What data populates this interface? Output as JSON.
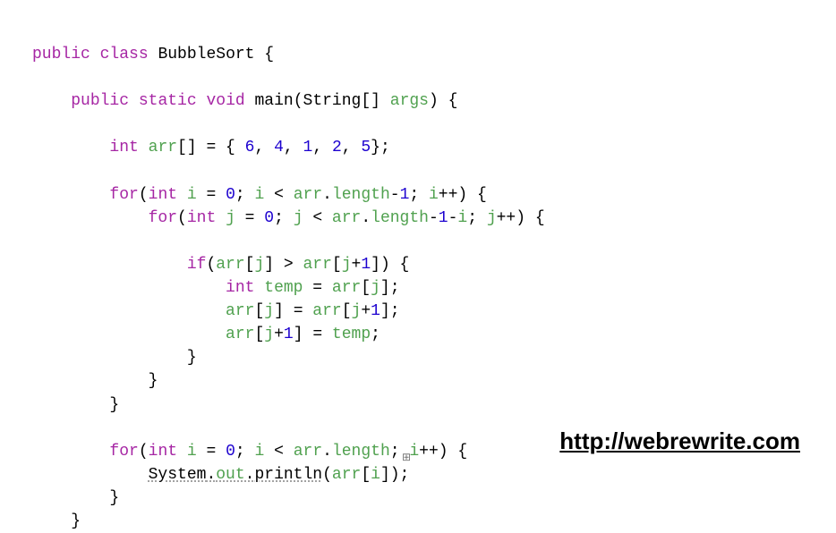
{
  "code": {
    "l1": {
      "kw1": "public",
      "kw2": "class",
      "name": "BubbleSort",
      "open": "{"
    },
    "l2": {
      "kw1": "public",
      "kw2": "static",
      "kw3": "void",
      "method": "main",
      "ptype": "String",
      "brackets": "[]",
      "pname": "args",
      "end": ") {"
    },
    "l3": {
      "kw": "int",
      "var": "arr",
      "br": "[]",
      "eq": " = { ",
      "v1": "6",
      "c1": ", ",
      "v2": "4",
      "c2": ", ",
      "v3": "1",
      "c3": ", ",
      "v4": "2",
      "c4": ", ",
      "v5": "5",
      "end": "};"
    },
    "l4": {
      "kw1": "for",
      "p1": "(",
      "kw2": "int",
      "v1": "i",
      "eq": " = ",
      "n0": "0",
      "sc1": "; ",
      "v2": "i",
      "lt": " < ",
      "v3": "arr",
      "dot": ".",
      "mem": "length",
      "minus": "-",
      "n1": "1",
      "sc2": "; ",
      "v4": "i",
      "inc": "++) {"
    },
    "l5": {
      "kw1": "for",
      "p1": "(",
      "kw2": "int",
      "v1": "j",
      "eq": " = ",
      "n0": "0",
      "sc1": "; ",
      "v2": "j",
      "lt": " < ",
      "v3": "arr",
      "dot": ".",
      "mem": "length",
      "minus1": "-",
      "n1": "1",
      "minus2": "-",
      "vii": "i",
      "sc2": "; ",
      "v4": "j",
      "inc": "++) {"
    },
    "l6": {
      "kw": "if",
      "p1": "(",
      "a1": "arr",
      "b1": "[",
      "j1": "j",
      "b2": "]",
      "gt": " > ",
      "a2": "arr",
      "b3": "[",
      "j2": "j",
      "plus": "+",
      "n1": "1",
      "b4": "]) {"
    },
    "l7": {
      "kw": "int",
      "v1": "temp",
      "eq": " = ",
      "a": "arr",
      "b1": "[",
      "j": "j",
      "b2": "];"
    },
    "l8": {
      "a1": "arr",
      "b1": "[",
      "j1": "j",
      "b2": "]",
      "eq": " = ",
      "a2": "arr",
      "b3": "[",
      "j2": "j",
      "plus": "+",
      "n1": "1",
      "b4": "];"
    },
    "l9": {
      "a1": "arr",
      "b1": "[",
      "j1": "j",
      "plus": "+",
      "n1": "1",
      "b2": "]",
      "eq": " = ",
      "v": "temp",
      "end": ";"
    },
    "l10": {
      "brace": "}"
    },
    "l11": {
      "brace": "}"
    },
    "l12": {
      "brace": "}"
    },
    "l13": {
      "kw1": "for",
      "p1": "(",
      "kw2": "int",
      "v1": "i",
      "eq": " = ",
      "n0": "0",
      "sc1": "; ",
      "v2": "i",
      "lt": " < ",
      "v3": "arr",
      "dot": ".",
      "mem": "length",
      "sc2": "; ",
      "v4": "i",
      "inc": "++) {"
    },
    "l14": {
      "sys": "System",
      "d1": ".",
      "out": "out",
      "d2": ".",
      "pr": "println",
      "p1": "(",
      "a": "arr",
      "b1": "[",
      "i": "i",
      "b2": "]);"
    },
    "l15": {
      "brace": "}"
    },
    "l16": {
      "brace": "}"
    }
  },
  "attribution": "http://webrewrite.com",
  "handle": "⊞"
}
